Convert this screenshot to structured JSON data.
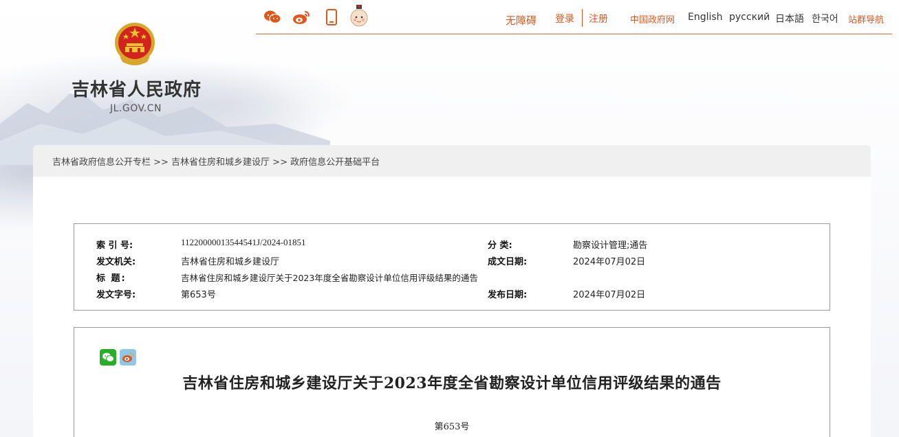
{
  "header": {
    "site_name": "吉林省人民政府",
    "site_domain": "JL.GOV.CN",
    "social_icons": [
      "wechat-icon",
      "weibo-icon",
      "mobile-icon",
      "mascot-icon"
    ],
    "nav": {
      "accessibility": "无障碍",
      "login": "登录",
      "register": "注册",
      "central_gov": "中国政府网",
      "english": "English",
      "russian": "русский",
      "japanese": "日本語",
      "korean": "한국어",
      "sitemap": "站群导航"
    },
    "accent_color": "#e0561b"
  },
  "breadcrumb": {
    "text": "吉林省政府信息公开专栏 >> 吉林省住房和城乡建设厅 >> 政府信息公开基础平台"
  },
  "meta": {
    "index_label": "索 引 号:",
    "index_value": "11220000013544541J/2024-01851",
    "category_label": "分 类:",
    "category_value": "勘察设计管理;通告",
    "issuer_label": "发文机关:",
    "issuer_value": "吉林省住房和城乡建设厅",
    "created_label": "成文日期:",
    "created_value": "2024年07月02日",
    "title_label": "标 题:",
    "title_value": "吉林省住房和城乡建设厅关于2023年度全省勘察设计单位信用评级结果的通告",
    "doc_no_label": "发文字号:",
    "doc_no_value": "第653号",
    "published_label": "发布日期:",
    "published_value": "2024年07月02日"
  },
  "article": {
    "share_icons": [
      "wechat-share-icon",
      "weibo-share-icon"
    ],
    "title": "吉林省住房和城乡建设厅关于2023年度全省勘察设计单位信用评级结果的通告",
    "number": "第653号"
  }
}
